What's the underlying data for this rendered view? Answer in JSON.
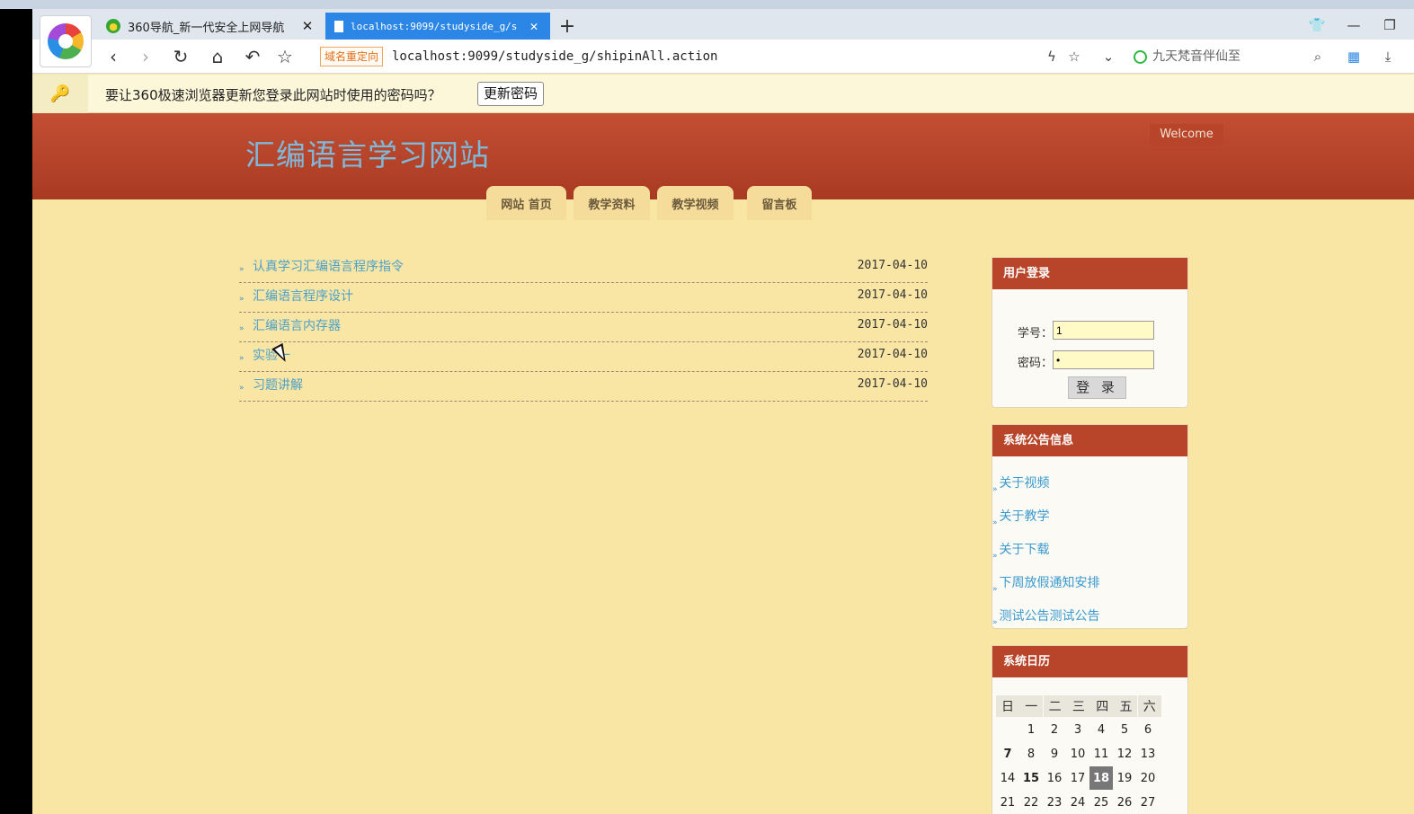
{
  "browser": {
    "tabs": [
      {
        "title": "360导航_新一代安全上网导航",
        "favicon": "360-nav-icon"
      },
      {
        "title": "localhost:9099/studyside_g/s",
        "favicon": "page-icon"
      }
    ],
    "redirect_badge": "域名重定向",
    "url": "localhost:9099/studyside_g/shipinAll.action",
    "search_placeholder": "九天梵音伴仙至"
  },
  "password_bar": {
    "message": "要让360极速浏览器更新您登录此网站时使用的密码吗？",
    "button": "更新密码"
  },
  "site": {
    "title": "汇编语言学习网站",
    "welcome": "Welcome",
    "nav": [
      "网站 首页",
      "教学资料",
      "教学视频",
      "留言板"
    ]
  },
  "videos": [
    {
      "title": "认真学习汇编语言程序指令",
      "date": "2017-04-10"
    },
    {
      "title": "汇编语言程序设计",
      "date": "2017-04-10"
    },
    {
      "title": "汇编语言内存器",
      "date": "2017-04-10"
    },
    {
      "title": "实验一",
      "date": "2017-04-10"
    },
    {
      "title": "习题讲解",
      "date": "2017-04-10"
    }
  ],
  "login": {
    "header": "用户登录",
    "id_label": "学号：",
    "id_value": "1",
    "pw_label": "密码：",
    "pw_value": "•",
    "button": "登 录"
  },
  "notices": {
    "header": "系统公告信息",
    "items": [
      "关于视频",
      "关于教学",
      "关于下载",
      "下周放假通知安排",
      "测试公告测试公告"
    ]
  },
  "calendar": {
    "header": "系统日历",
    "weekdays": [
      "日",
      "一",
      "二",
      "三",
      "四",
      "五",
      "六"
    ],
    "weeks": [
      [
        "",
        "1",
        "2",
        "3",
        "4",
        "5",
        "6"
      ],
      [
        "7",
        "8",
        "9",
        "10",
        "11",
        "12",
        "13"
      ],
      [
        "14",
        "15",
        "16",
        "17",
        "18",
        "19",
        "20"
      ],
      [
        "21",
        "22",
        "23",
        "24",
        "25",
        "26",
        "27"
      ]
    ],
    "today": "18"
  },
  "colors": {
    "header_red": "#b84529",
    "page_bg": "#f9e5a4",
    "link_blue": "#4da0c8",
    "tab_active": "#2b86e6"
  }
}
